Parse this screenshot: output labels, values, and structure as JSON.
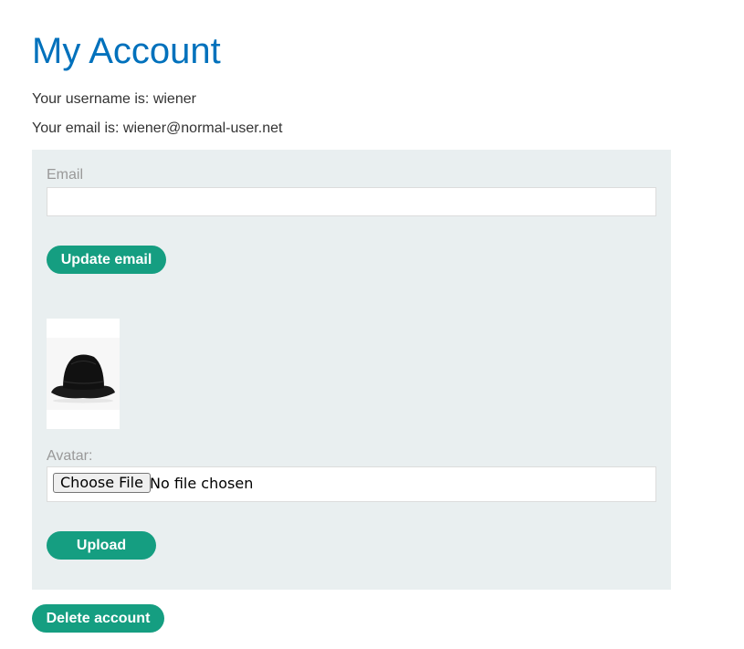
{
  "page": {
    "title": "My Account"
  },
  "account": {
    "username_text": "Your username is: wiener",
    "email_text": "Your email is: wiener@normal-user.net"
  },
  "email_form": {
    "label": "Email",
    "value": "",
    "placeholder": "",
    "submit_label": "Update email"
  },
  "avatar_form": {
    "image_alt": "avatar",
    "image_icon": "bucket-hat-image",
    "label": "Avatar:",
    "choose_file_label": "Choose File",
    "file_status": "No file chosen",
    "submit_label": "Upload"
  },
  "actions": {
    "delete_label": "Delete account"
  },
  "colors": {
    "title": "#0071bc",
    "button": "#159e81",
    "panel": "#e9eff0",
    "muted_label": "#999999"
  }
}
